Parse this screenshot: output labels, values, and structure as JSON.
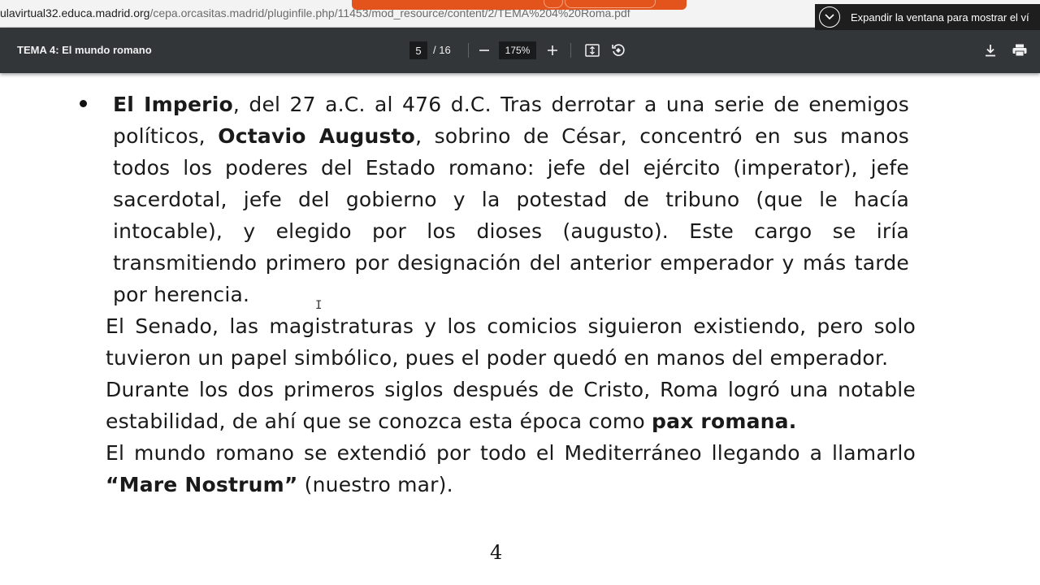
{
  "browser": {
    "url_host": "ulavirtual32.educa.madrid.org",
    "url_path": "/cepa.orcasitas.madrid/pluginfile.php/11453/mod_resource/content/2/TEMA%204%20Roma.pdf",
    "expand_tooltip": "Expandir la ventana para mostrar el ví"
  },
  "toolbar": {
    "title": "TEMA 4: El mundo romano",
    "current_page": "5",
    "page_total": "/ 16",
    "zoom": "175%"
  },
  "content": {
    "bullet": {
      "l1_bold": "El Imperio",
      "l1_rest": ", del 27 a.C. al 476 d.C. Tras derrotar a una serie de enemigos",
      "l2_pre": "políticos, ",
      "l2_bold": "Octavio Augusto",
      "l2_rest": ", sobrino de César, concentró en sus manos",
      "l3": "todos los poderes del Estado romano: jefe del ejército (imperator), jefe",
      "l4": "sacerdotal, jefe del gobierno y la potestad de tribuno (que le hacía",
      "l5": "intocable), y elegido por los dioses (augusto). Este cargo se iría",
      "l6": "transmitiendo primero por designación del anterior emperador y más tarde",
      "l7": "por herencia."
    },
    "p1_l1": "El Senado, las magistraturas y los comicios siguieron existiendo, pero solo",
    "p1_l2": "tuvieron un papel simbólico, pues el poder quedó en manos del emperador.",
    "p2_l1": "Durante los dos primeros siglos después de Cristo, Roma logró una notable",
    "p2_l2_pre": "estabilidad, de ahí que se conozca esta época como ",
    "p2_l2_bold": "pax romana.",
    "p3_l1": "El mundo romano se extendió por todo el Mediterráneo llegando a llamarlo",
    "p3_l2_bold": "“Mare Nostrum”",
    "p3_l2_rest": " (nuestro mar).",
    "page_number": "4"
  },
  "colors": {
    "toolbar_bg": "#323639",
    "accent_tab": "#e3541d"
  }
}
